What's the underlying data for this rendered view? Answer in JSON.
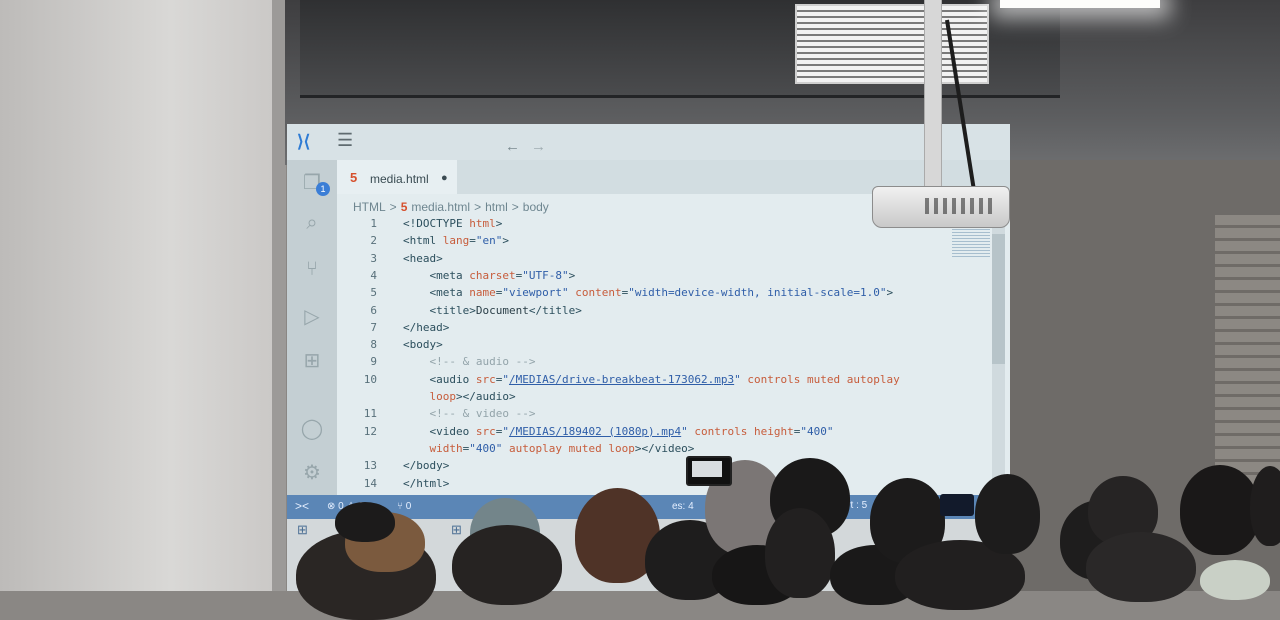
{
  "editor": {
    "tab": {
      "filename": "media.html",
      "modified_dot": "●",
      "icon": "html5-icon"
    },
    "breadcrumbs": [
      "HTML",
      ">",
      "media.html",
      ">",
      "html",
      ">",
      "body"
    ],
    "lines": [
      {
        "n": "1",
        "parts": [
          [
            "tag",
            "<!DOCTYPE "
          ],
          [
            "attr",
            "html"
          ],
          [
            "tag",
            ">"
          ]
        ]
      },
      {
        "n": "2",
        "parts": [
          [
            "tag",
            "<html "
          ],
          [
            "attr",
            "lang"
          ],
          [
            "tag",
            "="
          ],
          [
            "str",
            "\"en\""
          ],
          [
            "tag",
            ">"
          ]
        ]
      },
      {
        "n": "3",
        "parts": [
          [
            "tag",
            "<head>"
          ]
        ]
      },
      {
        "n": "4",
        "parts": [
          [
            "tag",
            "    <meta "
          ],
          [
            "attr",
            "charset"
          ],
          [
            "tag",
            "="
          ],
          [
            "str",
            "\"UTF-8\""
          ],
          [
            "tag",
            ">"
          ]
        ]
      },
      {
        "n": "5",
        "parts": [
          [
            "tag",
            "    <meta "
          ],
          [
            "attr",
            "name"
          ],
          [
            "tag",
            "="
          ],
          [
            "str",
            "\"viewport\" "
          ],
          [
            "attr",
            "content"
          ],
          [
            "tag",
            "="
          ],
          [
            "str",
            "\"width=device-width, initial-scale=1.0\""
          ],
          [
            "tag",
            ">"
          ]
        ]
      },
      {
        "n": "6",
        "parts": [
          [
            "tag",
            "    <title>"
          ],
          [
            "",
            "Document"
          ],
          [
            "tag",
            "</title>"
          ]
        ]
      },
      {
        "n": "7",
        "parts": [
          [
            "tag",
            "</head>"
          ]
        ]
      },
      {
        "n": "8",
        "parts": [
          [
            "tag",
            "<body>"
          ]
        ]
      },
      {
        "n": "9",
        "parts": [
          [
            "cmt",
            "    <!-- & audio -->"
          ]
        ]
      },
      {
        "n": "10",
        "parts": [
          [
            "tag",
            "    <audio "
          ],
          [
            "attr",
            "src"
          ],
          [
            "tag",
            "="
          ],
          [
            "str",
            "\""
          ],
          [
            "link",
            "/MEDIAS/drive-breakbeat-173062.mp3"
          ],
          [
            "str",
            "\" "
          ],
          [
            "attr",
            "controls muted autoplay"
          ]
        ]
      },
      {
        "n": "",
        "parts": [
          [
            "attr",
            "    loop"
          ],
          [
            "tag",
            "></audio>"
          ]
        ]
      },
      {
        "n": "11",
        "parts": [
          [
            "cmt",
            "    <!-- & video -->"
          ]
        ]
      },
      {
        "n": "12",
        "parts": [
          [
            "tag",
            "    <video "
          ],
          [
            "attr",
            "src"
          ],
          [
            "tag",
            "="
          ],
          [
            "str",
            "\""
          ],
          [
            "link",
            "/MEDIAS/189402 (1080p).mp4"
          ],
          [
            "str",
            "\" "
          ],
          [
            "attr",
            "controls height"
          ],
          [
            "tag",
            "="
          ],
          [
            "str",
            "\"400\""
          ]
        ]
      },
      {
        "n": "",
        "parts": [
          [
            "attr",
            "    width"
          ],
          [
            "tag",
            "="
          ],
          [
            "str",
            "\"400\" "
          ],
          [
            "attr",
            "autoplay muted loop"
          ],
          [
            "tag",
            "></video>"
          ]
        ]
      },
      {
        "n": "13",
        "parts": [
          [
            "tag",
            "</body>"
          ]
        ]
      },
      {
        "n": "14",
        "parts": [
          [
            "tag",
            "</html>"
          ]
        ]
      }
    ],
    "status": {
      "errors": "⊗ 0  ⚠ 0",
      "warnings": "⑂ 0",
      "spaces": "es: 4",
      "port": "Port : 5"
    }
  },
  "colors": {
    "accent": "#2d7bd4",
    "statusbar": "#5b86b6",
    "html_icon": "#d6502d"
  },
  "icons": [
    "vscode-logo-icon",
    "menu-icon",
    "arrow-left-icon",
    "arrow-right-icon",
    "files-icon",
    "search-icon",
    "source-control-icon",
    "run-debug-icon",
    "extensions-icon",
    "account-icon",
    "settings-icon"
  ]
}
